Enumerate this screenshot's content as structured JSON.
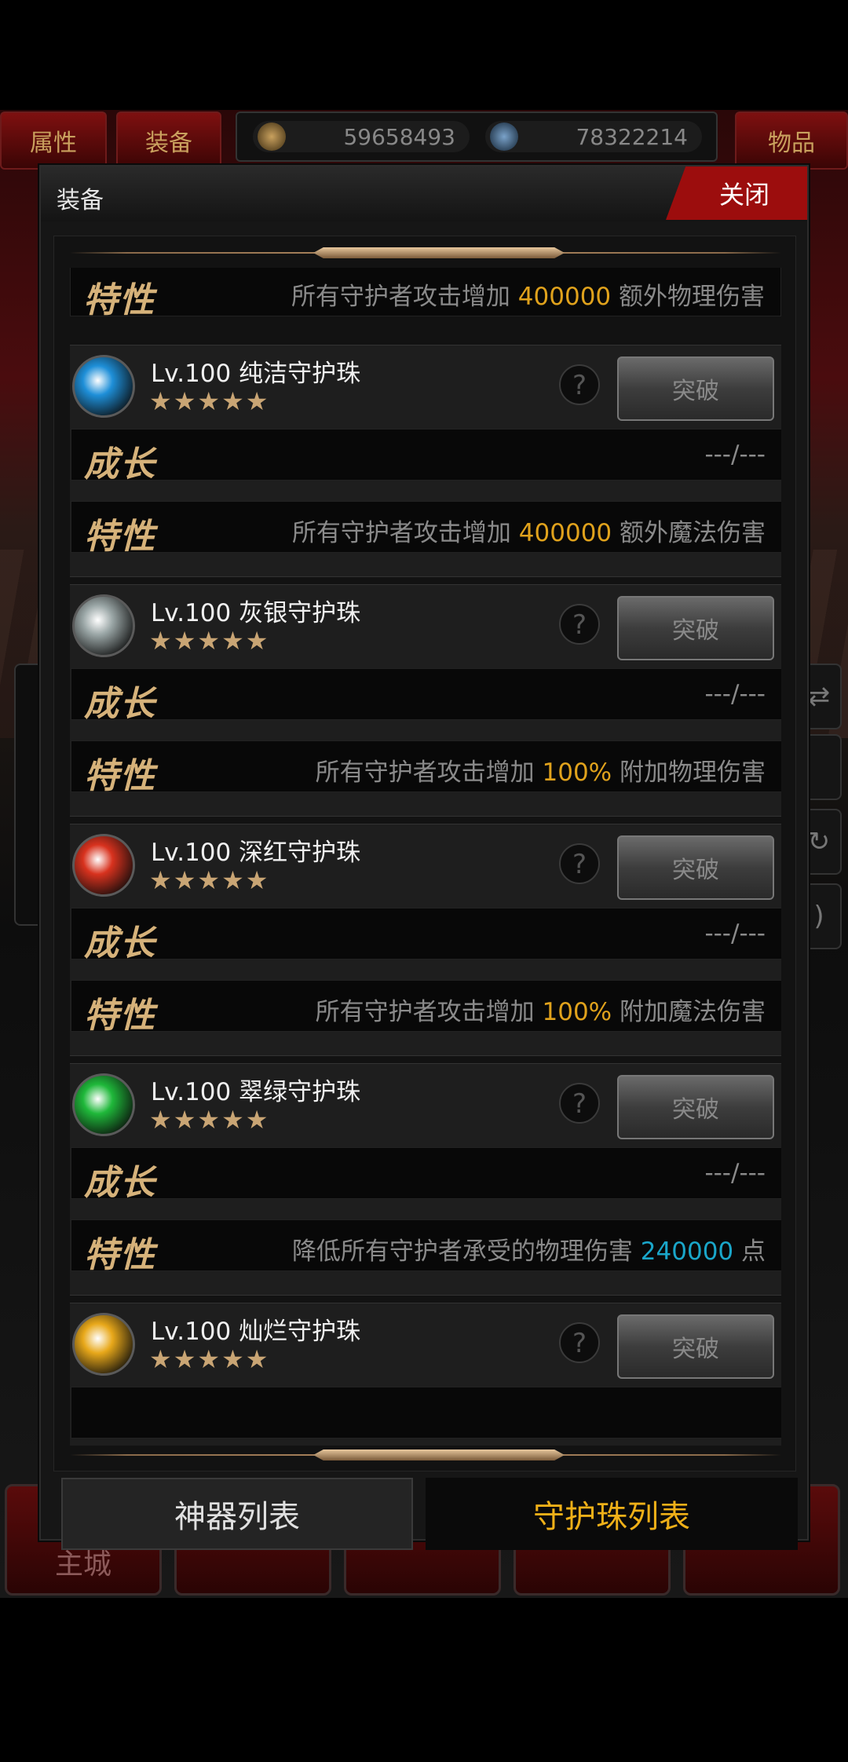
{
  "top_bar": {
    "tab_attributes": "属性",
    "tab_equipment": "装备",
    "tab_items": "物品",
    "currency_1": "59658493",
    "currency_2": "78322214"
  },
  "bottom_nav": {
    "main_city": "主城"
  },
  "dialog": {
    "title": "装备",
    "close_label": "关闭",
    "growth_label": "成长",
    "trait_label": "特性",
    "break_label": "突破",
    "help_glyph": "?",
    "stars": "★★★★★",
    "growth_value": "---/---",
    "top_trait": {
      "prefix": "所有守护者攻击增加 ",
      "value": "400000",
      "suffix": " 额外物理伤害"
    },
    "items": [
      {
        "name": "Lv.100 纯洁守护珠",
        "orb_color": "#1e8fd8",
        "trait_prefix": "所有守护者攻击增加 ",
        "trait_value": "400000",
        "trait_suffix": " 额外魔法伤害"
      },
      {
        "name": "Lv.100 灰银守护珠",
        "orb_color": "#9aa6a6",
        "trait_prefix": "所有守护者攻击增加 ",
        "trait_value": "100%",
        "trait_suffix": " 附加物理伤害"
      },
      {
        "name": "Lv.100 深红守护珠",
        "orb_color": "#d8321e",
        "trait_prefix": "所有守护者攻击增加 ",
        "trait_value": "100%",
        "trait_suffix": " 附加魔法伤害"
      },
      {
        "name": "Lv.100 翠绿守护珠",
        "orb_color": "#1fb83a",
        "trait_prefix": "降低所有守护者承受的物理伤害 ",
        "trait_value": "240000",
        "trait_suffix": " 点"
      },
      {
        "name": "Lv.100 灿烂守护珠",
        "orb_color": "#e8a81a"
      }
    ],
    "tab_artifacts": "神器列表",
    "tab_orbs": "守护珠列表"
  }
}
